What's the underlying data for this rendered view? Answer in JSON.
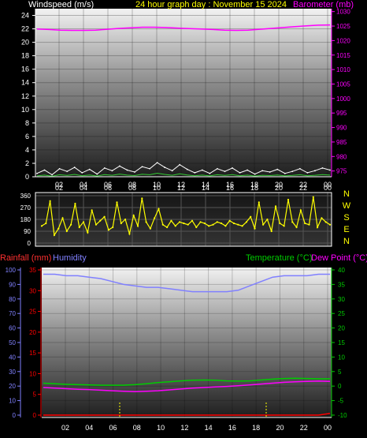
{
  "header": {
    "windspeed_label": "Windspeed (m/s)",
    "title": "24 hour graph day : November 15 2024",
    "barometer_label": "Barometer (mb)"
  },
  "lower_header": {
    "rainfall_label": "Rainfall (mm)",
    "humidity_label": "Humidity",
    "temperature_label": "Temperature (°C)",
    "dewpoint_label": "Dew Point (°C)"
  },
  "colors": {
    "windspeed": "#ffffff",
    "wind_gust": "#33cc33",
    "barometer": "#ff00ff",
    "title": "#ffff00",
    "wind_direction": "#ffff00",
    "rainfall": "#ff0000",
    "humidity": "#8080ff",
    "temperature": "#00cc00",
    "dewpoint": "#ff00ff"
  },
  "chart_data": [
    {
      "type": "line",
      "name": "wind-barometer",
      "x_tick_labels": [
        "02",
        "04",
        "06",
        "08",
        "10",
        "12",
        "14",
        "16",
        "18",
        "20",
        "22",
        "00"
      ],
      "y_left_ticks": [
        0,
        2,
        4,
        6,
        8,
        10,
        12,
        14,
        16,
        18,
        20,
        22,
        24
      ],
      "y_left_range": [
        0,
        25
      ],
      "y_right_ticks": [
        975,
        980,
        985,
        990,
        995,
        1000,
        1005,
        1010,
        1015,
        1020,
        1025,
        1030
      ],
      "y_right_range": [
        973,
        1031
      ],
      "series": [
        {
          "key": "wind",
          "values": [
            0.5,
            1.0,
            0.3,
            1.2,
            0.8,
            1.4,
            0.6,
            1.1,
            0.4,
            1.3,
            0.9,
            1.6,
            1.0,
            0.7,
            1.5,
            1.2,
            2.1,
            1.4,
            0.9,
            1.8,
            1.1,
            0.6,
            1.0,
            0.5,
            1.2,
            0.8,
            1.3,
            0.6,
            1.0,
            0.4,
            0.9,
            0.7,
            1.1,
            0.5,
            0.8,
            1.2,
            0.6,
            0.9,
            1.3,
            1.0
          ]
        },
        {
          "key": "barometer",
          "values": [
            1024.0,
            1023.8,
            1023.6,
            1023.5,
            1023.5,
            1023.6,
            1023.9,
            1024.2,
            1024.4,
            1024.6,
            1024.6,
            1024.5,
            1024.3,
            1024.1,
            1024.0,
            1023.8,
            1023.6,
            1023.5,
            1023.6,
            1023.9,
            1024.2,
            1024.5,
            1024.8,
            1025.1,
            1025.3,
            1025.4
          ]
        }
      ]
    },
    {
      "type": "line",
      "name": "wind-direction",
      "x_tick_labels": [
        "02",
        "04",
        "06",
        "08",
        "10",
        "12",
        "14",
        "16",
        "18",
        "20",
        "22",
        "00"
      ],
      "y_ticks": [
        0,
        90,
        180,
        270,
        360
      ],
      "y_range": [
        0,
        360
      ],
      "compass_labels": [
        "N",
        "W",
        "S",
        "E",
        "N"
      ],
      "values": [
        130,
        150,
        320,
        60,
        110,
        190,
        90,
        140,
        300,
        120,
        160,
        80,
        250,
        140,
        170,
        200,
        100,
        120,
        310,
        150,
        180,
        70,
        210,
        130,
        340,
        160,
        110,
        190,
        260,
        140,
        120,
        170,
        130,
        160,
        150,
        140,
        170,
        120,
        160,
        150,
        130,
        140,
        160,
        150,
        130,
        170,
        150,
        140,
        130,
        160,
        200,
        110,
        310,
        140,
        180,
        90,
        280,
        150,
        130,
        330,
        160,
        120,
        250,
        150,
        140,
        350,
        120,
        190,
        160,
        140
      ]
    },
    {
      "type": "line",
      "name": "rain-humidity-temperature",
      "x_tick_labels": [
        "02",
        "04",
        "06",
        "08",
        "10",
        "12",
        "14",
        "16",
        "18",
        "20",
        "22",
        "00"
      ],
      "y_left_ticks": [
        0,
        10,
        20,
        30,
        40,
        50,
        60,
        70,
        80,
        90,
        100
      ],
      "y_left_range": [
        0,
        100
      ],
      "rain_ticks": [
        0,
        5,
        10,
        15,
        20,
        25,
        30,
        35
      ],
      "rain_range": [
        0,
        35
      ],
      "y_right_ticks": [
        -10,
        -5,
        0,
        5,
        10,
        15,
        20,
        25,
        30,
        35,
        40
      ],
      "y_right_range": [
        -10,
        40
      ],
      "series": [
        {
          "key": "humidity",
          "values": [
            97,
            97,
            96,
            96,
            95,
            94,
            92,
            90,
            89,
            88,
            88,
            87,
            86,
            85,
            85,
            85,
            85,
            86,
            89,
            92,
            95,
            96,
            96,
            96,
            97,
            97
          ]
        },
        {
          "key": "temperature",
          "values": [
            1.0,
            0.8,
            0.6,
            0.5,
            0.4,
            0.3,
            0.3,
            0.3,
            0.5,
            0.8,
            1.2,
            1.5,
            1.8,
            2.0,
            2.1,
            2.0,
            1.8,
            1.7,
            1.8,
            2.1,
            2.4,
            2.6,
            2.7,
            2.6,
            2.5,
            2.5
          ]
        },
        {
          "key": "dewpoint",
          "values": [
            -0.5,
            -0.7,
            -0.9,
            -1.1,
            -1.2,
            -1.4,
            -1.6,
            -1.8,
            -1.9,
            -1.8,
            -1.6,
            -1.3,
            -1.0,
            -0.7,
            -0.5,
            -0.3,
            -0.1,
            0.1,
            0.4,
            0.7,
            1.0,
            1.3,
            1.5,
            1.6,
            1.7,
            1.6
          ]
        },
        {
          "key": "rainfall",
          "values": [
            0,
            0,
            0,
            0,
            0,
            0,
            0,
            0,
            0,
            0,
            0,
            0,
            0,
            0,
            0,
            0,
            0,
            0,
            0,
            0,
            0,
            0,
            0,
            0,
            0,
            0.4
          ]
        }
      ]
    }
  ]
}
